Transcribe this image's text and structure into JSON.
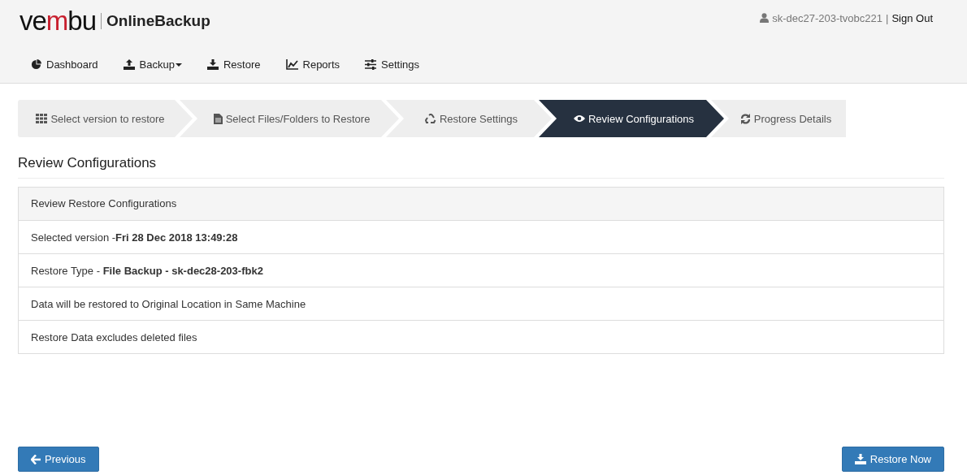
{
  "logo": {
    "segments": [
      {
        "text": "ve",
        "accent": false
      },
      {
        "text": "m",
        "accent": true
      },
      {
        "text": "bu",
        "accent": false
      }
    ],
    "product": "OnlineBackup"
  },
  "user": {
    "name": "sk-dec27-203-tvobc221",
    "separator": "|",
    "sign_out": "Sign Out"
  },
  "nav": [
    {
      "label": "Dashboard",
      "dropdown": false
    },
    {
      "label": "Backup",
      "dropdown": true
    },
    {
      "label": "Restore",
      "dropdown": false
    },
    {
      "label": "Reports",
      "dropdown": false
    },
    {
      "label": "Settings",
      "dropdown": false
    }
  ],
  "steps": [
    {
      "label": "Select version to restore",
      "selected": false
    },
    {
      "label": "Select Files/Folders to Restore",
      "selected": false
    },
    {
      "label": "Restore Settings",
      "selected": false
    },
    {
      "label": "Review Configurations",
      "selected": true
    },
    {
      "label": "Progress Details",
      "selected": false
    }
  ],
  "section_title": "Review Configurations",
  "panel": {
    "heading": "Review Restore Configurations",
    "rows": [
      "Selected version -**Fri 28 Dec 2018 13:49:28**",
      "Restore Type - **File Backup - sk-dec28-203-fbk2**",
      "Data will be restored to Original Location in Same Machine",
      "Restore Data excludes deleted files"
    ]
  },
  "buttons": {
    "previous": "Previous",
    "next": "Restore Now"
  }
}
